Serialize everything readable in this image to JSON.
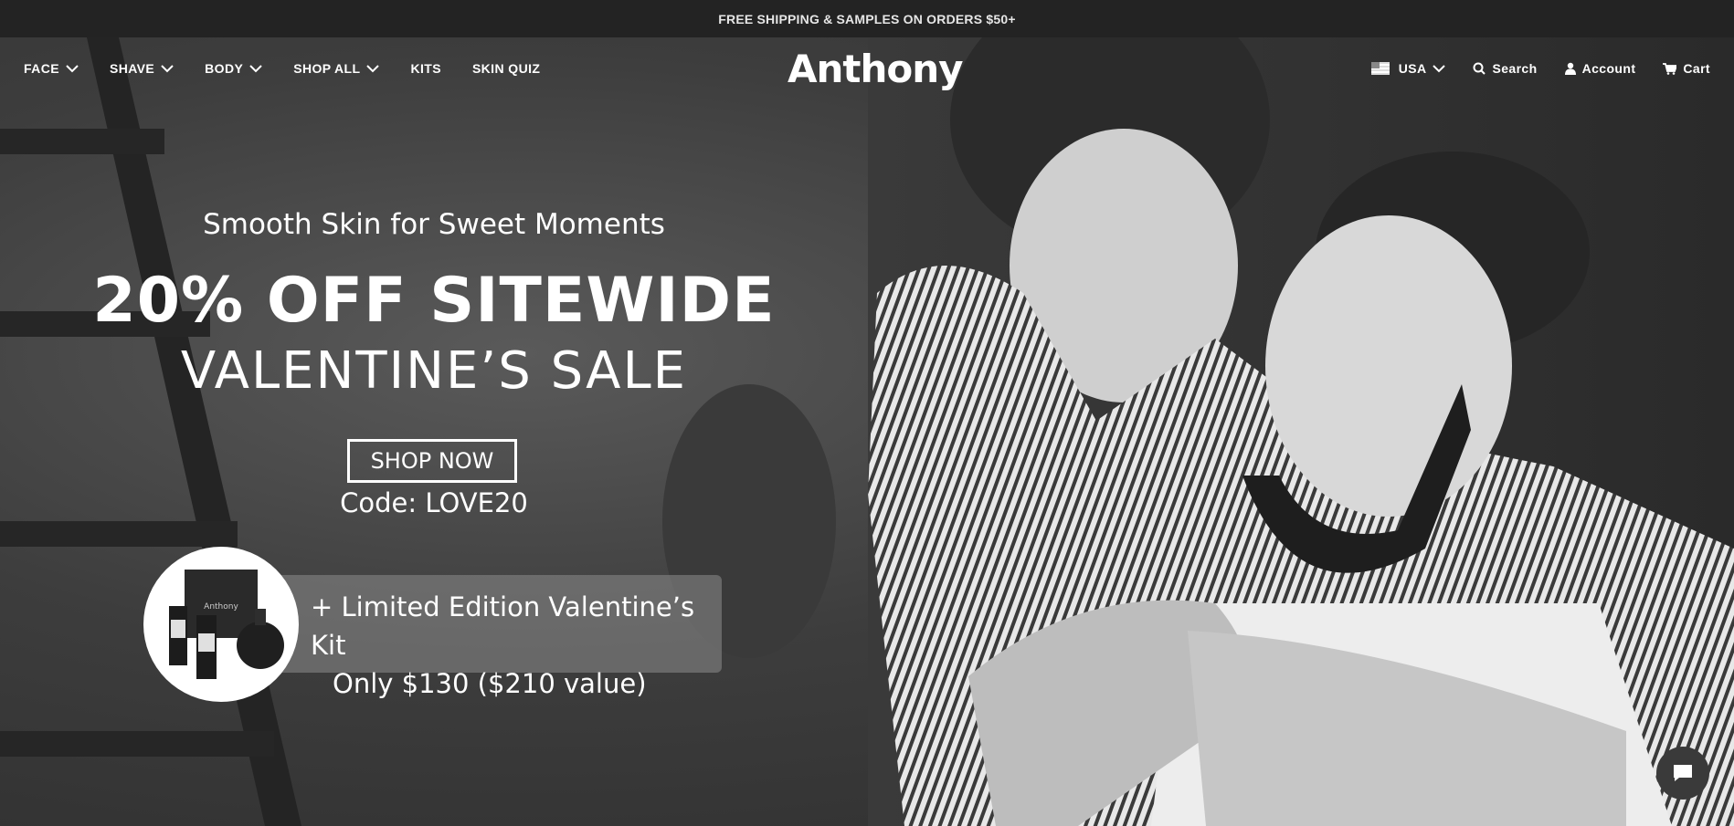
{
  "announcement": {
    "text": "FREE SHIPPING & SAMPLES ON ORDERS $50+"
  },
  "nav": {
    "left": [
      {
        "label": "FACE",
        "dropdown": true
      },
      {
        "label": "SHAVE",
        "dropdown": true
      },
      {
        "label": "BODY",
        "dropdown": true
      },
      {
        "label": "SHOP ALL",
        "dropdown": true
      },
      {
        "label": "KITS",
        "dropdown": false
      },
      {
        "label": "SKIN QUIZ",
        "dropdown": false
      }
    ],
    "logo": "Anthony",
    "country": "USA",
    "search": "Search",
    "account": "Account",
    "cart": "Cart"
  },
  "hero": {
    "subtitle": "Smooth Skin for Sweet Moments",
    "headline": "20% OFF SITEWIDE",
    "sale": "VALENTINE’S SALE",
    "cta": "SHOP NOW",
    "code": "Code: LOVE20",
    "kit_line1": "+ Limited Edition Valentine’s Kit",
    "kit_line2": "Only $130 ($210 value)",
    "kit_box_label": "Anthony"
  },
  "icons": {
    "search": "search-icon",
    "account": "user-icon",
    "cart": "cart-icon",
    "chat": "chat-bubble-icon",
    "chevron": "chevron-down-icon",
    "flag": "us-flag-icon"
  },
  "colors": {
    "bar": "#232323",
    "text": "#ffffff"
  }
}
